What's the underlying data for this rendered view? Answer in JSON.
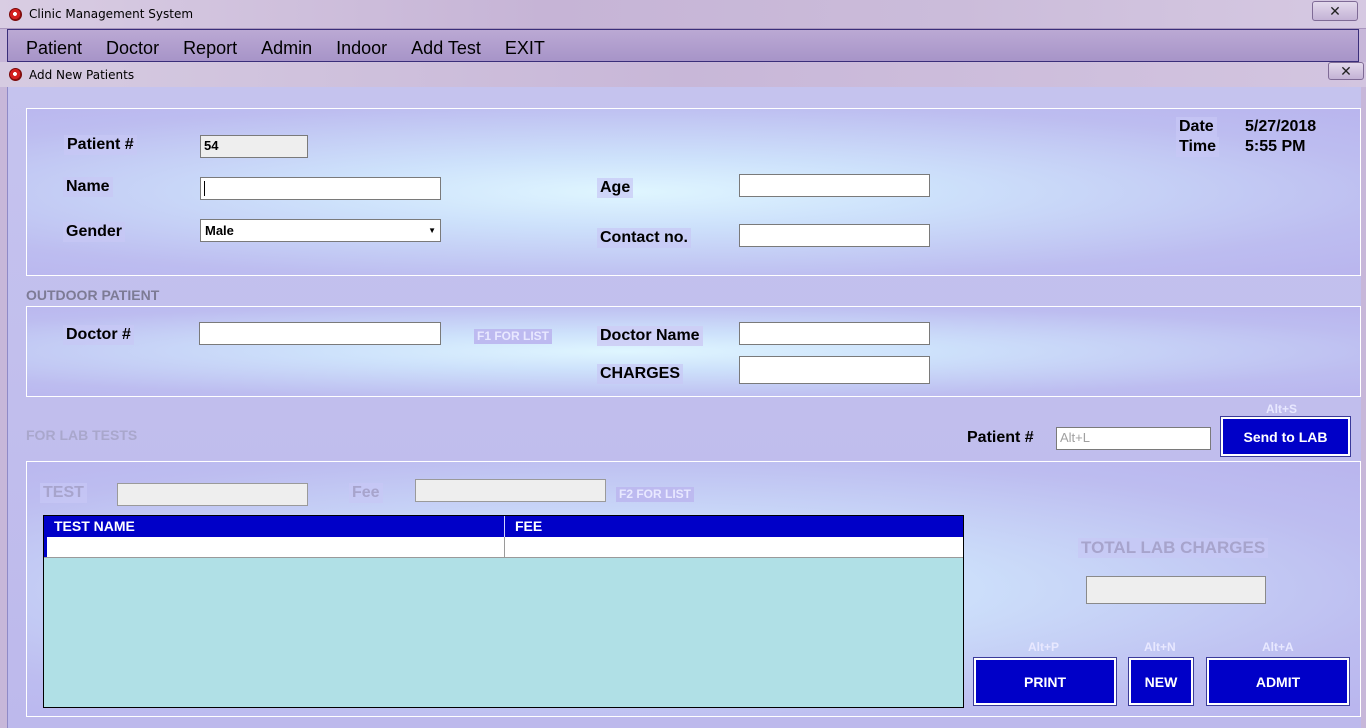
{
  "app": {
    "title": "Clinic Management System",
    "close_glyph": "✕"
  },
  "menu": [
    {
      "label": "Patient"
    },
    {
      "label": "Doctor"
    },
    {
      "label": "Report"
    },
    {
      "label": "Admin"
    },
    {
      "label": "Indoor"
    },
    {
      "label": "Add Test"
    },
    {
      "label": "EXIT"
    }
  ],
  "form": {
    "title": "Add New Patients",
    "close_glyph": "✕",
    "patient": {
      "patient_no_label": "Patient #",
      "patient_no_value": "54",
      "name_label": "Name",
      "name_value": "",
      "gender_label": "Gender",
      "gender_value": "Male",
      "age_label": "Age",
      "age_value": "",
      "contact_label": "Contact no.",
      "contact_value": "",
      "date_label": "Date",
      "date_value": "5/27/2018",
      "time_label": "Time",
      "time_value": "5:55 PM"
    },
    "outdoor": {
      "section_title": "OUTDOOR PATIENT",
      "doctor_no_label": "Doctor #",
      "doctor_no_value": "",
      "f1_hint": "F1 FOR LIST",
      "doctor_name_label": "Doctor Name",
      "doctor_name_value": "",
      "charges_label": "CHARGES",
      "charges_value": ""
    },
    "lab": {
      "section_title": "FOR LAB TESTS",
      "patient_no_label": "Patient #",
      "patient_no_placeholder": "Alt+L",
      "send_shortcut": "Alt+S",
      "send_button": "Send to LAB",
      "test_label": "TEST",
      "test_value": "",
      "fee_label": "Fee",
      "fee_value": "",
      "f2_hint": "F2 FOR LIST",
      "grid_columns": [
        "TEST NAME",
        "FEE"
      ],
      "grid_rows": [
        [
          "",
          ""
        ]
      ],
      "total_label": "TOTAL LAB CHARGES",
      "total_value": ""
    },
    "actions": {
      "print_shortcut": "Alt+P",
      "print_button": "PRINT",
      "new_shortcut": "Alt+N",
      "new_button": "NEW",
      "admit_shortcut": "Alt+A",
      "admit_button": "ADMIT"
    }
  },
  "colors": {
    "accent": "#0000c8",
    "grid_bg": "#b0e0e6",
    "panel_bg": "#bdbaf0"
  }
}
